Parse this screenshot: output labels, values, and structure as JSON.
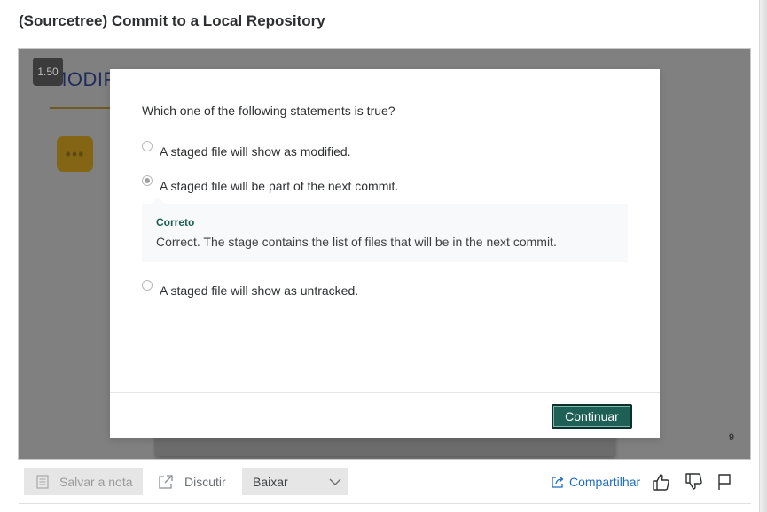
{
  "page": {
    "title": "(Sourcetree) Commit to a Local Repository"
  },
  "video": {
    "speed": "1.50",
    "slide_heading": "MODIF",
    "slide_number": "9"
  },
  "quiz": {
    "question": "Which one of the following statements is true?",
    "options": [
      {
        "label": "A staged file will show as modified.",
        "selected": false
      },
      {
        "label": "A staged file will be part of the next commit.",
        "selected": true
      },
      {
        "label": "A staged file will show as untracked.",
        "selected": false
      }
    ],
    "feedback": {
      "title": "Correto",
      "text": "Correct. The stage contains the list of files that will be in the next commit."
    },
    "continue_label": "Continuar"
  },
  "toolbar": {
    "save_note_label": "Salvar a nota",
    "discuss_label": "Discutir",
    "download_label": "Baixar",
    "share_label": "Compartilhar"
  },
  "colors": {
    "accent_green": "#1e6055",
    "link_blue": "#1e6dbf"
  }
}
